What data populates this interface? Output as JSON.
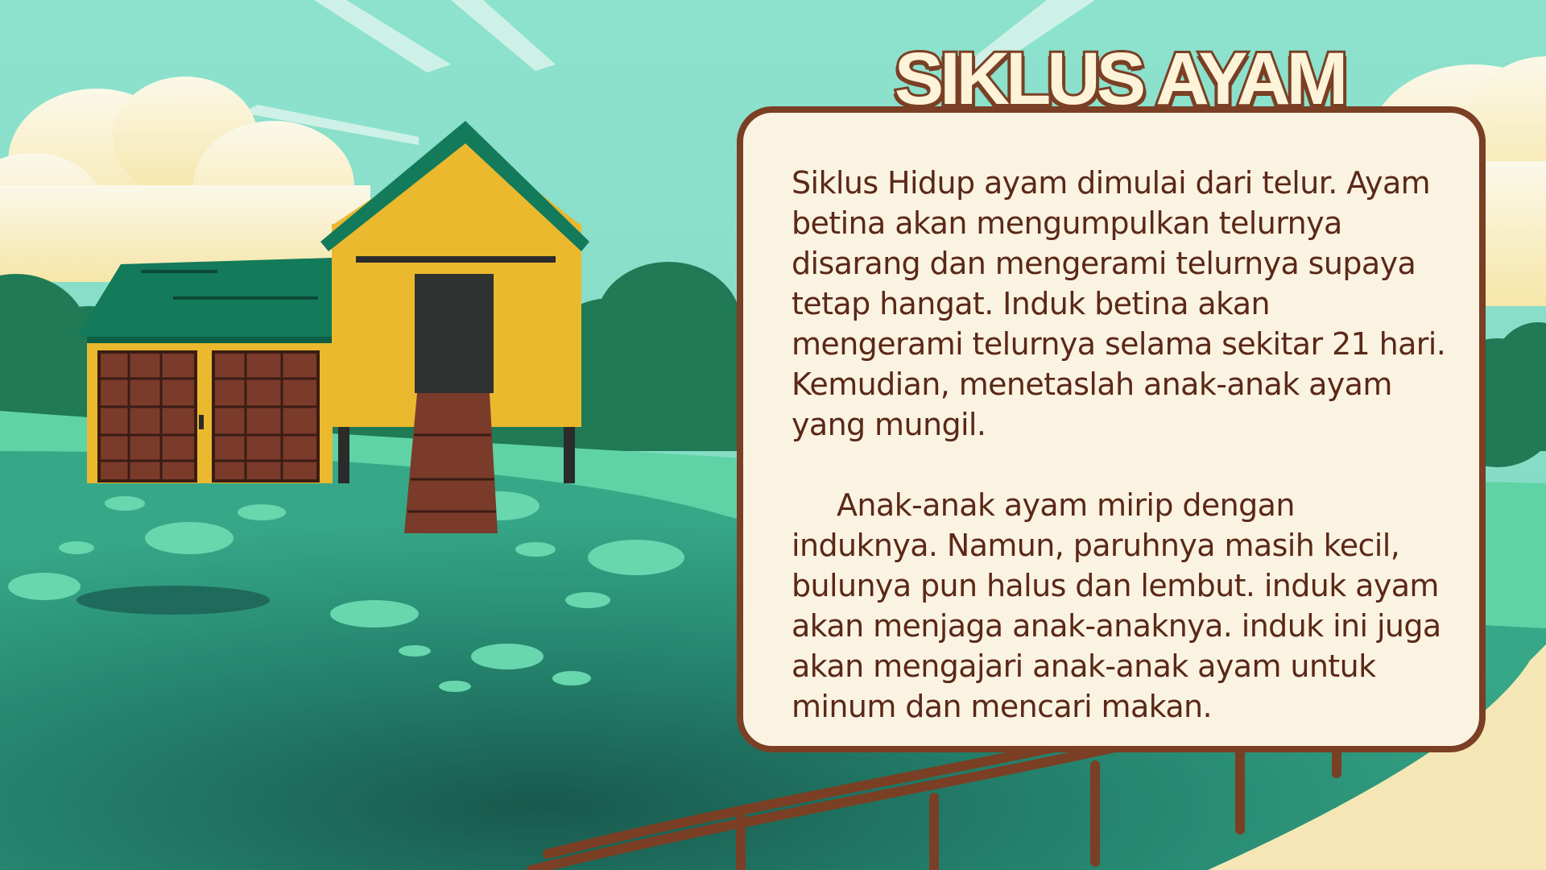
{
  "title": "SIKLUS AYAM",
  "paragraphs": [
    "Siklus Hidup ayam dimulai dari telur. Ayam\nbetina akan mengumpulkan telurnya\ndisarang dan mengerami telurnya supaya\ntetap hangat. Induk betina akan\nmengerami telurnya selama sekitar 21 hari.\nKemudian, menetaslah anak-anak ayam\nyang mungil.",
    "Anak-anak ayam mirip dengan\ninduknya. Namun, paruhnya masih kecil,\nbulunya pun halus dan lembut. induk ayam\nakan menjaga anak-anaknya. induk ini juga\nakan mengajari anak-anak ayam untuk\nminum dan mencari makan."
  ],
  "colors": {
    "sky": "#7fdcc4",
    "grass": "#2a9a7e",
    "card_bg": "#fbf3e1",
    "card_border": "#7a3f24",
    "text": "#5a2818",
    "house_wall": "#eab92e",
    "house_roof": "#137a5a",
    "door": "#7a3b2b",
    "path": "#f5e7b5",
    "fence": "#7a3f24"
  }
}
